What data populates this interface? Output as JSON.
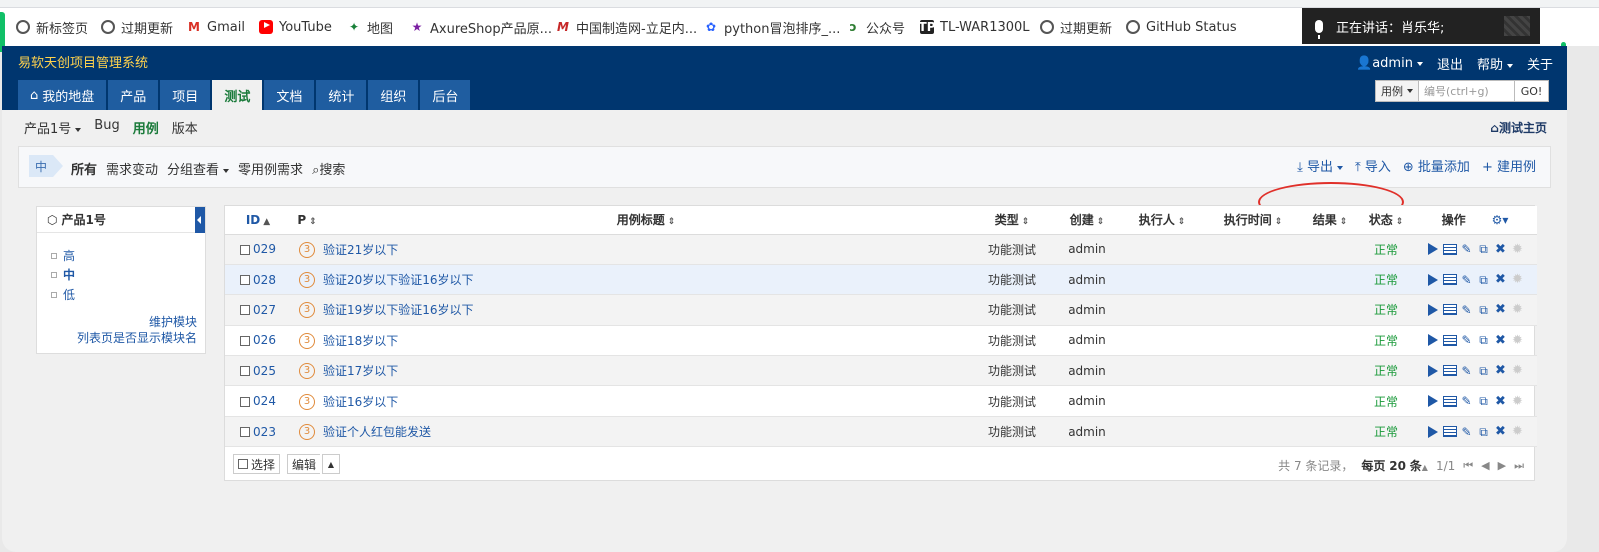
{
  "bookmarks": [
    {
      "label": "新标签页",
      "icon": "globe-icon"
    },
    {
      "label": "过期更新",
      "icon": "globe-icon"
    },
    {
      "label": "Gmail",
      "icon": "gmail-icon"
    },
    {
      "label": "YouTube",
      "icon": "youtube-icon"
    },
    {
      "label": "地图",
      "icon": "maps-icon"
    },
    {
      "label": "AxureShop产品原...",
      "icon": "star-icon"
    },
    {
      "label": "中国制造网-立足内...",
      "icon": "made-in-china-icon"
    },
    {
      "label": "python冒泡排序_...",
      "icon": "baidu-paw-icon"
    },
    {
      "label": "公众号",
      "icon": "wechat-icon"
    },
    {
      "label": "TL-WAR1300L",
      "icon": "tp-link-icon"
    },
    {
      "label": "过期更新",
      "icon": "globe-icon"
    },
    {
      "label": "GitHub Status",
      "icon": "globe-icon"
    }
  ],
  "voice": {
    "text": "正在讲话：肖乐华;"
  },
  "header": {
    "app_title": "易软天创项目管理系统",
    "user": "admin",
    "logout": "退出",
    "help": "帮助",
    "about": "关于"
  },
  "nav": {
    "home": "我的地盘",
    "tabs": [
      "产品",
      "项目",
      "测试",
      "文档",
      "统计",
      "组织",
      "后台"
    ],
    "active": "测试"
  },
  "quickjump": {
    "select": "用例",
    "placeholder": "编号(ctrl+g)",
    "go": "GO!"
  },
  "subnav": {
    "product": "产品1号",
    "items": [
      "Bug",
      "用例",
      "版本"
    ],
    "active": "用例",
    "home_link": "测试主页"
  },
  "toolbar": {
    "priority_flag": "中",
    "filters": [
      "所有",
      "需求变动",
      "分组查看",
      "零用例需求"
    ],
    "search": "搜索",
    "export": "导出",
    "import": "导入",
    "batch_add": "批量添加",
    "create": "建用例"
  },
  "sidebar": {
    "title": "产品1号",
    "modules": [
      "高",
      "中",
      "低"
    ],
    "links": [
      "维护模块",
      "列表页是否显示模块名"
    ]
  },
  "table": {
    "columns": [
      "ID",
      "P",
      "用例标题",
      "类型",
      "创建",
      "执行人",
      "执行时间",
      "结果",
      "状态",
      "操作"
    ],
    "rows": [
      {
        "id": "029",
        "p": "3",
        "title": "验证21岁以下",
        "type": "功能测试",
        "creator": "admin",
        "executor": "",
        "exec_time": "",
        "result": "",
        "status": "正常"
      },
      {
        "id": "028",
        "p": "3",
        "title": "验证20岁以下验证16岁以下",
        "type": "功能测试",
        "creator": "admin",
        "executor": "",
        "exec_time": "",
        "result": "",
        "status": "正常"
      },
      {
        "id": "027",
        "p": "3",
        "title": "验证19岁以下验证16岁以下",
        "type": "功能测试",
        "creator": "admin",
        "executor": "",
        "exec_time": "",
        "result": "",
        "status": "正常"
      },
      {
        "id": "026",
        "p": "3",
        "title": "验证18岁以下",
        "type": "功能测试",
        "creator": "admin",
        "executor": "",
        "exec_time": "",
        "result": "",
        "status": "正常"
      },
      {
        "id": "025",
        "p": "3",
        "title": "验证17岁以下",
        "type": "功能测试",
        "creator": "admin",
        "executor": "",
        "exec_time": "",
        "result": "",
        "status": "正常"
      },
      {
        "id": "024",
        "p": "3",
        "title": "验证16岁以下",
        "type": "功能测试",
        "creator": "admin",
        "executor": "",
        "exec_time": "",
        "result": "",
        "status": "正常"
      },
      {
        "id": "023",
        "p": "3",
        "title": "验证个人红包能发送",
        "type": "功能测试",
        "creator": "admin",
        "executor": "",
        "exec_time": "",
        "result": "",
        "status": "正常"
      }
    ]
  },
  "footer": {
    "select": "选择",
    "edit": "编辑",
    "pager_total": "共 7 条记录，",
    "per_page_prefix": "每页",
    "per_page": "20",
    "per_page_suffix": "条",
    "page": "1/1"
  },
  "colors": {
    "header_bg": "#00366f",
    "active_green": "#1a7a3a",
    "link_blue": "#1f58a6",
    "highlight_red": "#e0302a"
  }
}
